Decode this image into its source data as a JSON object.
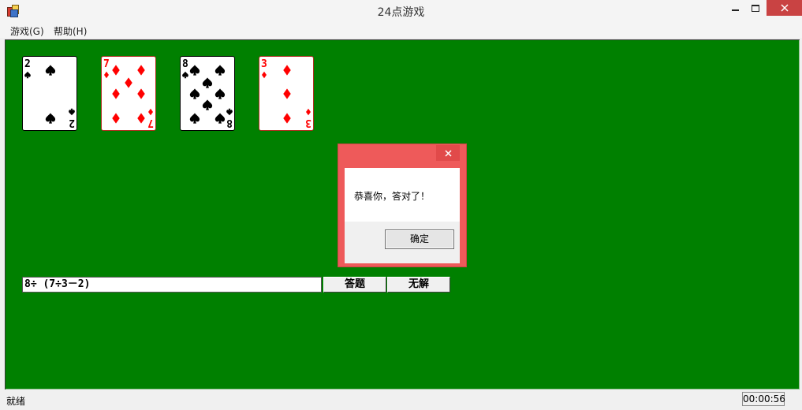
{
  "window": {
    "title": "24点游戏"
  },
  "menu": {
    "items": [
      "游戏(G)",
      "帮助(H)"
    ]
  },
  "cards": [
    {
      "rank": "2",
      "suit": "spade",
      "color": "#000000"
    },
    {
      "rank": "7",
      "suit": "diamond",
      "color": "#ff0000"
    },
    {
      "rank": "8",
      "suit": "spade",
      "color": "#000000"
    },
    {
      "rank": "3",
      "suit": "diamond",
      "color": "#ff0000"
    }
  ],
  "expression": {
    "value": "8÷ (7÷3－2)"
  },
  "buttons": {
    "answer": "答题",
    "no_solution": "无解"
  },
  "dialog": {
    "message": "恭喜你，答对了！",
    "ok": "确定"
  },
  "status": {
    "text": "就绪",
    "timer": "00:00:56"
  },
  "colors": {
    "table_green": "#008000",
    "dialog_frame": "#ee5a5a"
  }
}
